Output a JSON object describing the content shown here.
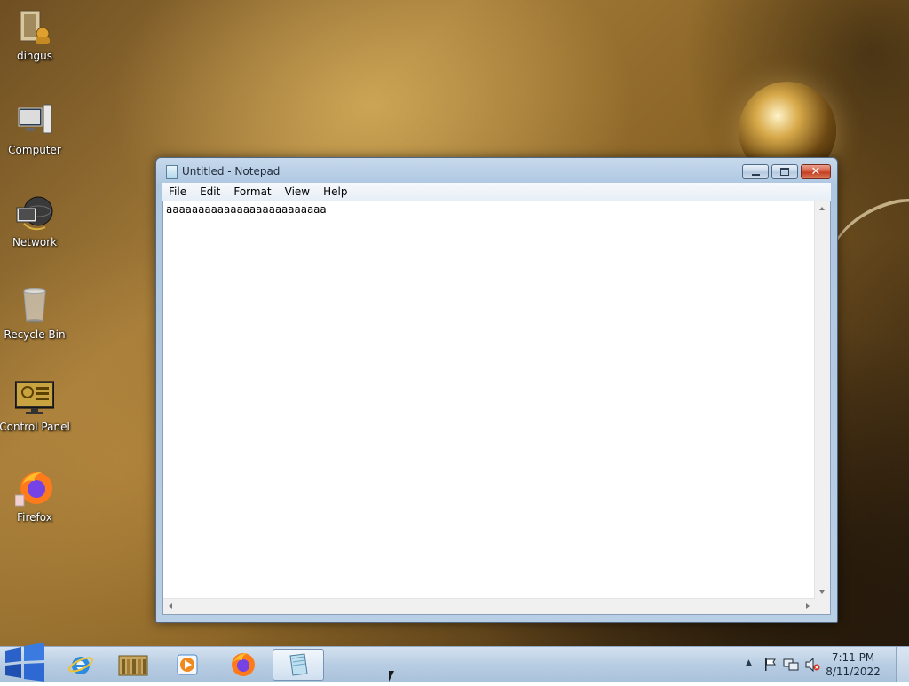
{
  "desktop": {
    "icons": [
      {
        "label": "dingus"
      },
      {
        "label": "Computer"
      },
      {
        "label": "Network"
      },
      {
        "label": "Recycle Bin"
      },
      {
        "label": "Control Panel"
      },
      {
        "label": "Firefox"
      }
    ]
  },
  "notepad": {
    "title": "Untitled - Notepad",
    "menu": [
      "File",
      "Edit",
      "Format",
      "View",
      "Help"
    ],
    "content": "aaaaaaaaaaaaaaaaaaaaaaaaa",
    "close_symbol": "✕"
  },
  "taskbar": {
    "pinned": [
      {
        "icon": "internet-explorer-icon"
      },
      {
        "icon": "library-icon"
      },
      {
        "icon": "media-player-icon"
      },
      {
        "icon": "firefox-icon"
      },
      {
        "icon": "notepad-icon",
        "active": true
      }
    ],
    "tray": {
      "show_hidden_symbol": "▲",
      "time": "7:11 PM",
      "date": "8/11/2022"
    }
  },
  "colors": {
    "taskbar": "#b8cde3",
    "window_frame": "#aec7e1",
    "close_button": "#c13a1f"
  }
}
